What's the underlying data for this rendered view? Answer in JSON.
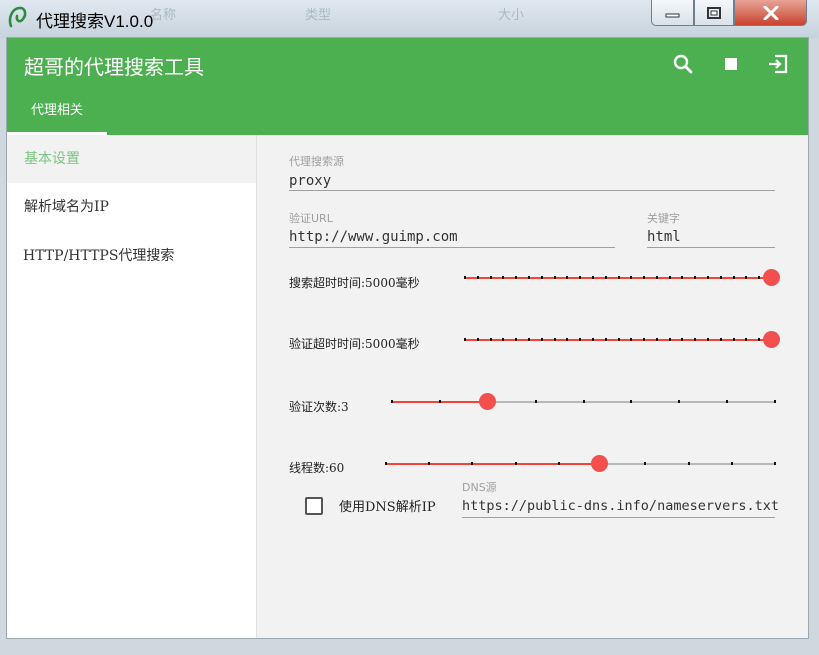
{
  "window": {
    "title": "代理搜索V1.0.0",
    "background_headers": [
      "名称",
      "类型",
      "大小"
    ],
    "background_row": [
      "",
      "",
      ""
    ]
  },
  "appbar": {
    "title": "超哥的代理搜索工具",
    "accent": "#4caf50",
    "actions": [
      {
        "icon": "search-icon"
      },
      {
        "icon": "stop-icon"
      },
      {
        "icon": "exit-icon"
      }
    ],
    "tabs": [
      {
        "label": "代理相关",
        "active": true
      }
    ]
  },
  "sidebar": {
    "items": [
      {
        "label": "基本设置",
        "active": true
      },
      {
        "label": "解析域名为IP",
        "active": false
      },
      {
        "label": "HTTP/HTTPS代理搜索",
        "active": false
      }
    ]
  },
  "form": {
    "proxy_source": {
      "label": "代理搜索源",
      "value": "proxy"
    },
    "verify_url": {
      "label": "验证URL",
      "value": "http://www.guimp.com"
    },
    "keyword": {
      "label": "关键字",
      "value": "html"
    },
    "sliders": [
      {
        "label": "搜索超时时间:5000毫秒",
        "fraction": 1.0,
        "ticks": 25
      },
      {
        "label": "验证超时时间:5000毫秒",
        "fraction": 1.0,
        "ticks": 25
      },
      {
        "label": "验证次数:3",
        "fraction": 0.25,
        "ticks": 9
      },
      {
        "label": "线程数:60",
        "fraction": 0.55,
        "ticks": 10
      }
    ],
    "use_dns": {
      "label": "使用DNS解析IP",
      "checked": false
    },
    "dns_source": {
      "label": "DNS源",
      "value": "https://public-dns.info/nameservers.txt"
    },
    "slider_color": "#f44336"
  }
}
